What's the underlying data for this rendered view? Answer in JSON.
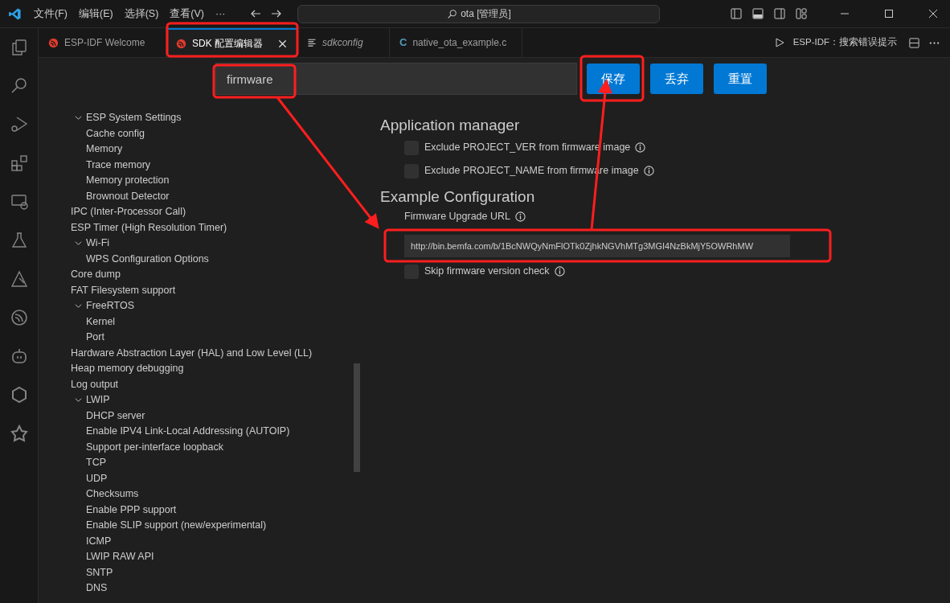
{
  "title_bar": {
    "menus": [
      "文件(F)",
      "编辑(E)",
      "选择(S)",
      "查看(V)",
      "···"
    ],
    "command_center": "ota [管理员]"
  },
  "tabs": [
    {
      "label": "ESP-IDF Welcome",
      "kind": "espressif",
      "selected": false,
      "preview": false
    },
    {
      "label": "SDK 配置编辑器",
      "kind": "espressif",
      "selected": true,
      "preview": false
    },
    {
      "label": "sdkconfig",
      "kind": "plain",
      "selected": false,
      "preview": true
    },
    {
      "label": "native_ota_example.c",
      "kind": "c",
      "icon_text": "C",
      "selected": false,
      "preview": false
    }
  ],
  "editor_actions": {
    "command": "ESP-IDF：搜索错误提示"
  },
  "search": {
    "value": "firmware"
  },
  "buttons": [
    "保存",
    "丢弃",
    "重置"
  ],
  "tree": [
    {
      "label": "ESP System Settings",
      "expanded": true,
      "children": [
        {
          "label": "Cache config"
        },
        {
          "label": "Memory"
        },
        {
          "label": "Trace memory"
        },
        {
          "label": "Memory protection"
        },
        {
          "label": "Brownout Detector"
        }
      ]
    },
    {
      "label": "IPC (Inter-Processor Call)"
    },
    {
      "label": "ESP Timer (High Resolution Timer)"
    },
    {
      "label": "Wi-Fi",
      "expanded": true,
      "children": [
        {
          "label": "WPS Configuration Options"
        }
      ]
    },
    {
      "label": "Core dump"
    },
    {
      "label": "FAT Filesystem support"
    },
    {
      "label": "FreeRTOS",
      "expanded": true,
      "children": [
        {
          "label": "Kernel"
        },
        {
          "label": "Port"
        }
      ]
    },
    {
      "label": "Hardware Abstraction Layer (HAL) and Low Level (LL)"
    },
    {
      "label": "Heap memory debugging"
    },
    {
      "label": "Log output"
    },
    {
      "label": "LWIP",
      "expanded": true,
      "children": [
        {
          "label": "DHCP server"
        },
        {
          "label": "Enable IPV4 Link-Local Addressing (AUTOIP)"
        },
        {
          "label": "Support per-interface loopback"
        },
        {
          "label": "TCP"
        },
        {
          "label": "UDP"
        },
        {
          "label": "Checksums"
        },
        {
          "label": "Enable PPP support"
        },
        {
          "label": "Enable SLIP support (new/experimental)"
        },
        {
          "label": "ICMP"
        },
        {
          "label": "LWIP RAW API"
        },
        {
          "label": "SNTP"
        },
        {
          "label": "DNS"
        }
      ]
    }
  ],
  "sections": [
    {
      "title": "Application manager",
      "options": [
        {
          "kind": "checkbox",
          "label": "Exclude PROJECT_VER from firmware image",
          "checked": false
        },
        {
          "kind": "checkbox",
          "label": "Exclude PROJECT_NAME from firmware image",
          "checked": false
        }
      ]
    },
    {
      "title": "Example Configuration",
      "options": [
        {
          "kind": "text",
          "label": "Firmware Upgrade URL",
          "value": "http://bin.bemfa.com/b/1BcNWQyNmFlOTk0ZjhkNGVhMTg3MGI4NzBkMjY5OWRhMW"
        },
        {
          "kind": "checkbox",
          "label": "Skip firmware version check",
          "checked": false
        }
      ]
    }
  ]
}
